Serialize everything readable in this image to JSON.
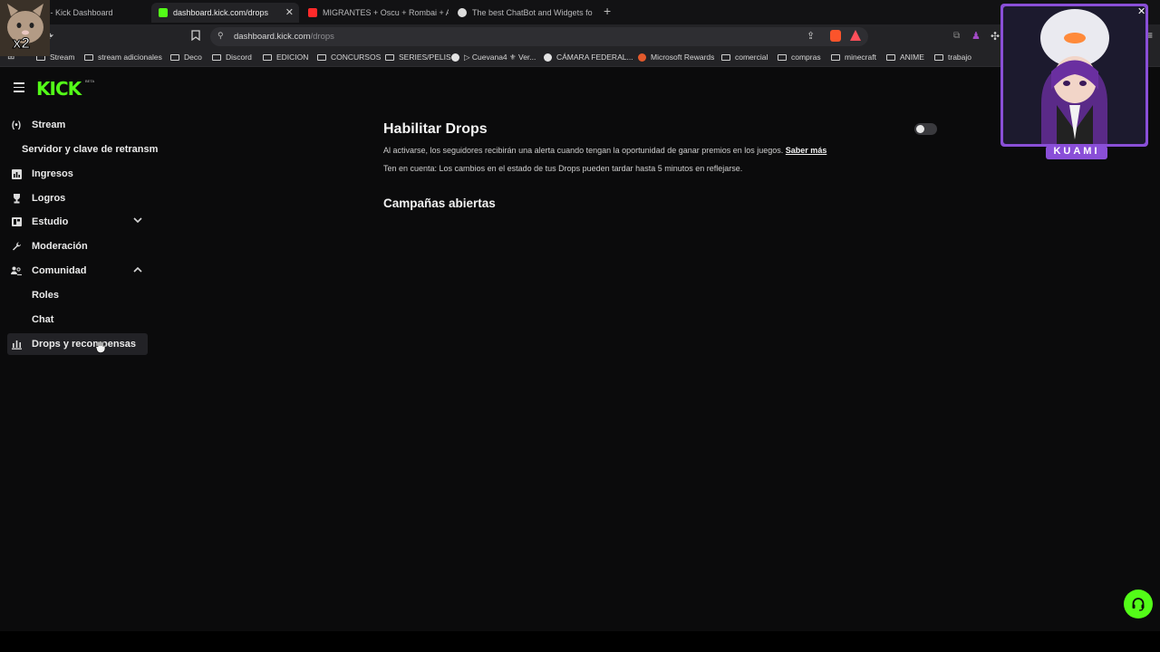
{
  "browser": {
    "tabs": [
      {
        "title": "Stream - Kick Dashboard",
        "active": false
      },
      {
        "title": "dashboard.kick.com/drops",
        "active": true
      },
      {
        "title": "MIGRANTES + Oscu + Rombai + AG",
        "active": false
      },
      {
        "title": "The best ChatBot and Widgets fo",
        "active": false
      }
    ],
    "url_main": "dashboard.kick.com",
    "url_path": "/drops",
    "bookmarks": [
      "Stream",
      "stream adicionales",
      "Deco",
      "Discord",
      "EDICION",
      "CONCURSOS",
      "SERIES/PELIS",
      "▷ Cuevana4 ⚜ Ver...",
      "CÁMARA FEDERAL...",
      "Microsoft Rewards",
      "comercial",
      "compras",
      "minecraft",
      "ANIME",
      "trabajo"
    ]
  },
  "brand": {
    "logo": "KICK",
    "beta": "BETA",
    "accent": "#53fc18"
  },
  "sidebar": {
    "stream": "Stream",
    "server_key": "Servidor y clave de retransm",
    "income": "Ingresos",
    "achievements": "Logros",
    "studio": "Estudio",
    "moderation": "Moderación",
    "community": "Comunidad",
    "roles": "Roles",
    "chat": "Chat",
    "drops": "Drops y recompensas"
  },
  "main": {
    "title": "Habilitar Drops",
    "description": "Al activarse, los seguidores recibirán una alerta cuando tengan la oportunidad de ganar premios en los juegos.",
    "learn_more": "Saber más",
    "note": "Ten en cuenta: Los cambios en el estado de tus Drops pueden tardar hasta 5 minutos en reflejarse.",
    "campaigns_title": "Campañas abiertas",
    "drops_enabled": false
  },
  "overlay": {
    "webcam_name": "KUAMI",
    "cat_label": "x2"
  }
}
